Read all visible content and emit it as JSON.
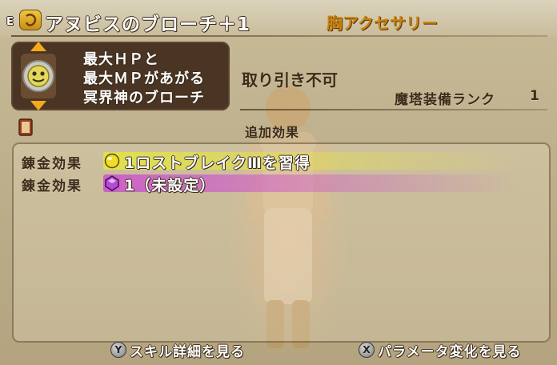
{
  "header": {
    "equip_mark": "E",
    "item_name": "アヌビスのブローチ＋1",
    "category": "胸アクセサリー"
  },
  "item_detail": {
    "description_lines": [
      "最大ＨＰと",
      "最大ＭＰがあがる",
      "冥界神のブローチ"
    ],
    "trade_status": "取り引き不可",
    "tower_rank_label": "魔塔装備ランク",
    "tower_rank_value": "1"
  },
  "effects": {
    "section_title": "追加効果",
    "rows": [
      {
        "label": "錬金効果",
        "orb": "yellow-orb-icon",
        "text": "1ロストブレイクⅢを習得"
      },
      {
        "label": "錬金効果",
        "orb": "purple-orb-icon",
        "text": "1（未設定）"
      }
    ]
  },
  "footer": {
    "skill_button": {
      "key": "Y",
      "label": "スキル詳細を見る"
    },
    "param_button": {
      "key": "X",
      "label": "パラメータ変化を見る"
    }
  },
  "colors": {
    "category_orange": "#c9830f",
    "rank_arrow": "#f2a91c",
    "glow_yellow": "#e2e248",
    "glow_purple": "#cd50cd"
  }
}
